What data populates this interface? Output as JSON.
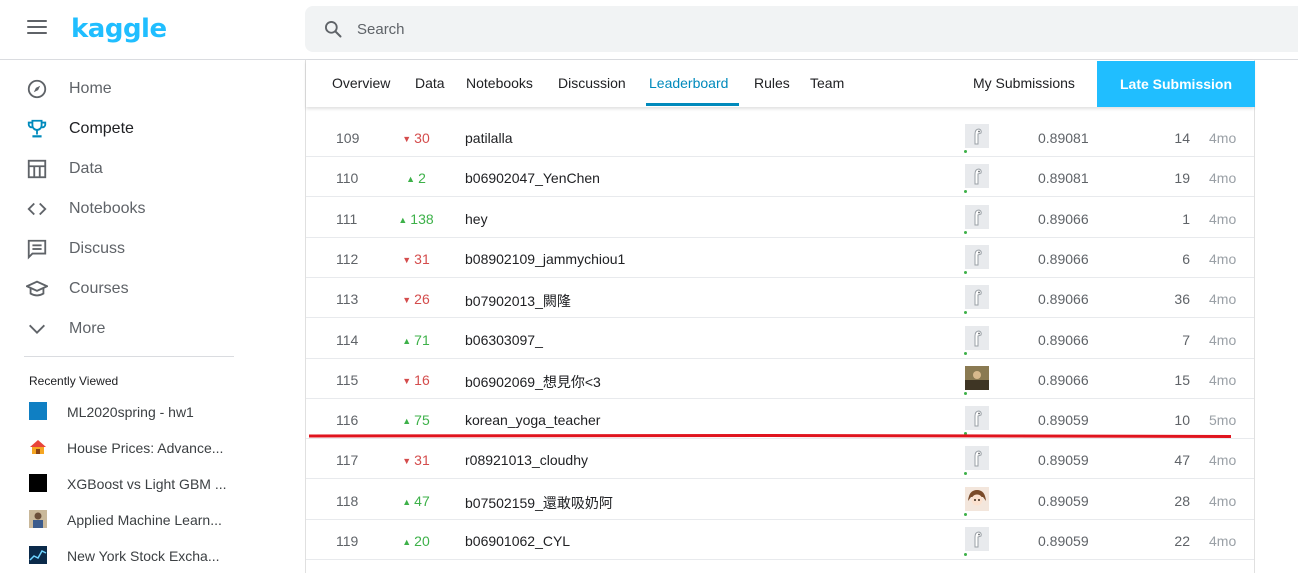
{
  "header": {
    "logo": "kaggle",
    "search_placeholder": "Search"
  },
  "sidebar": {
    "items": [
      {
        "label": "Home",
        "icon": "compass-icon"
      },
      {
        "label": "Compete",
        "icon": "trophy-icon",
        "active": true
      },
      {
        "label": "Data",
        "icon": "table-icon"
      },
      {
        "label": "Notebooks",
        "icon": "code-icon"
      },
      {
        "label": "Discuss",
        "icon": "comment-icon"
      },
      {
        "label": "Courses",
        "icon": "graduation-cap-icon"
      },
      {
        "label": "More",
        "icon": "chevron-down-icon"
      }
    ],
    "recently_viewed_title": "Recently Viewed",
    "recent": [
      {
        "label": "ML2020spring - hw1"
      },
      {
        "label": "House Prices: Advance..."
      },
      {
        "label": "XGBoost vs Light GBM ..."
      },
      {
        "label": "Applied Machine Learn..."
      },
      {
        "label": "New York Stock Excha..."
      }
    ]
  },
  "tabs": [
    {
      "label": "Overview"
    },
    {
      "label": "Data"
    },
    {
      "label": "Notebooks"
    },
    {
      "label": "Discussion"
    },
    {
      "label": "Leaderboard",
      "active": true
    },
    {
      "label": "Rules"
    },
    {
      "label": "Team"
    }
  ],
  "my_submissions": "My Submissions",
  "late_submission": "Late Submission",
  "colors": {
    "accent": "#20beff",
    "active_tab": "#008abc",
    "up": "#3db149",
    "down": "#d44c4c",
    "highlight_line": "#e0141e"
  },
  "leaderboard": [
    {
      "rank": "109",
      "dir": "down",
      "change": "30",
      "team": "patilalla",
      "avatar": "default",
      "score": "0.89081",
      "entries": "14",
      "last": "4mo"
    },
    {
      "rank": "110",
      "dir": "up",
      "change": "2",
      "team": "b06902047_YenChen",
      "avatar": "default",
      "score": "0.89081",
      "entries": "19",
      "last": "4mo"
    },
    {
      "rank": "111",
      "dir": "up",
      "change": "138",
      "team": "hey",
      "avatar": "default",
      "score": "0.89066",
      "entries": "1",
      "last": "4mo"
    },
    {
      "rank": "112",
      "dir": "down",
      "change": "31",
      "team": "b08902109_jammychiou1",
      "avatar": "default",
      "score": "0.89066",
      "entries": "6",
      "last": "4mo"
    },
    {
      "rank": "113",
      "dir": "down",
      "change": "26",
      "team": "b07902013_闕隆",
      "avatar": "default",
      "score": "0.89066",
      "entries": "36",
      "last": "4mo"
    },
    {
      "rank": "114",
      "dir": "up",
      "change": "71",
      "team": "b06303097_",
      "avatar": "default",
      "score": "0.89066",
      "entries": "7",
      "last": "4mo"
    },
    {
      "rank": "115",
      "dir": "down",
      "change": "16",
      "team": "b06902069_想見你<3",
      "avatar": "photo",
      "score": "0.89066",
      "entries": "15",
      "last": "4mo"
    },
    {
      "rank": "116",
      "dir": "up",
      "change": "75",
      "team": "korean_yoga_teacher",
      "avatar": "default",
      "score": "0.89059",
      "entries": "10",
      "last": "5mo"
    },
    {
      "rank": "117",
      "dir": "down",
      "change": "31",
      "team": "r08921013_cloudhy",
      "avatar": "default",
      "score": "0.89059",
      "entries": "47",
      "last": "4mo"
    },
    {
      "rank": "118",
      "dir": "up",
      "change": "47",
      "team": "b07502159_還敢吸奶阿",
      "avatar": "anime",
      "score": "0.89059",
      "entries": "28",
      "last": "4mo"
    },
    {
      "rank": "119",
      "dir": "up",
      "change": "20",
      "team": "b06901062_CYL",
      "avatar": "default",
      "score": "0.89059",
      "entries": "22",
      "last": "4mo"
    }
  ]
}
